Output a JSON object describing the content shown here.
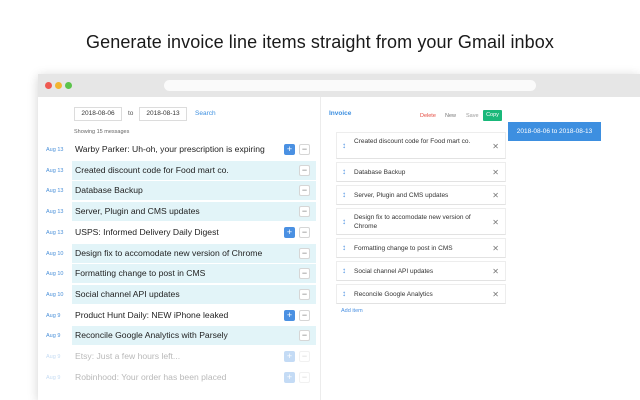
{
  "headline": "Generate invoice line items straight from your Gmail inbox",
  "filters": {
    "from_date": "2018-08-06",
    "to_label": "to",
    "to_date": "2018-08-13",
    "search_label": "Search",
    "showing": "Showing 15 messages"
  },
  "messages": [
    {
      "date": "Aug 13",
      "subject": "Warby Parker: Uh-oh, your prescription is expiring",
      "state": "available"
    },
    {
      "date": "Aug 13",
      "subject": "Created discount code for Food mart co.",
      "state": "added"
    },
    {
      "date": "Aug 13",
      "subject": "Database Backup",
      "state": "added"
    },
    {
      "date": "Aug 13",
      "subject": "Server, Plugin and CMS updates",
      "state": "added"
    },
    {
      "date": "Aug 13",
      "subject": "USPS: Informed Delivery Daily Digest",
      "state": "available"
    },
    {
      "date": "Aug 10",
      "subject": "Design fix to accomodate new version of Chrome",
      "state": "added"
    },
    {
      "date": "Aug 10",
      "subject": "Formatting change to post in CMS",
      "state": "added"
    },
    {
      "date": "Aug 10",
      "subject": "Social channel API updates",
      "state": "added"
    },
    {
      "date": "Aug 9",
      "subject": "Product Hunt Daily: NEW iPhone leaked",
      "state": "available"
    },
    {
      "date": "Aug 9",
      "subject": "Reconcile Google Analytics with Parsely",
      "state": "added"
    },
    {
      "date": "Aug 9",
      "subject": "Etsy: Just a few hours left...",
      "state": "available"
    },
    {
      "date": "Aug 9",
      "subject": "Robinhood: Your order has been placed",
      "state": "available"
    }
  ],
  "buttons": {
    "add_symbol": "+",
    "remove_symbol": "−"
  },
  "invoice": {
    "title": "Invoice",
    "delete_label": "Delete",
    "new_label": "New",
    "save_label": "Save",
    "copy_label": "Copy",
    "items": [
      "Created discount code for Food mart co.",
      "Database Backup",
      "Server, Plugin and CMS updates",
      "Design fix to accomodate new version of Chrome",
      "Formatting change to post in CMS",
      "Social channel API updates",
      "Reconcile Google Analytics"
    ],
    "add_item_label": "Add item",
    "range_label": "2018-08-06 to 2018-08-13"
  },
  "icons": {
    "drag": "drag-handle-icon",
    "close": "close-icon"
  },
  "colors": {
    "accent": "#3d8fe0",
    "copy": "#19b87a",
    "delete": "#e5493f",
    "added_row": "#e2f4f8"
  }
}
